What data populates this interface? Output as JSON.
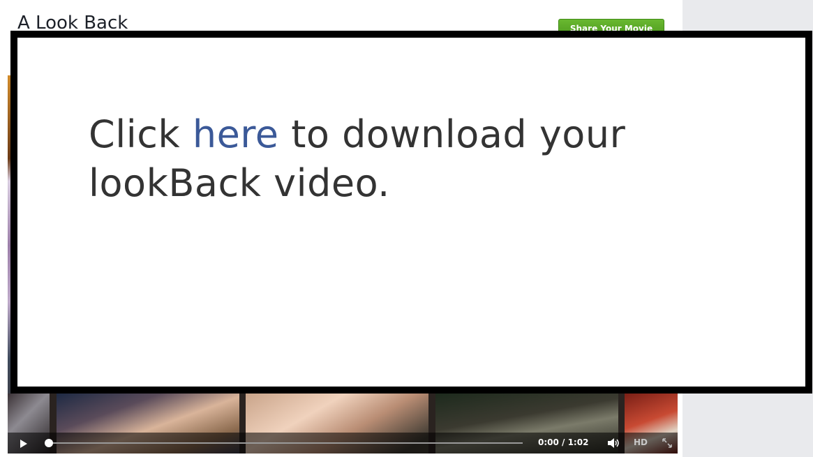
{
  "header": {
    "title": "A Look Back",
    "share_button_label": "Share Your Movie"
  },
  "video": {
    "time_readout": "0:00 / 1:02",
    "hd_label": "HD",
    "progress": 0.0
  },
  "overlay": {
    "message_before": "Click ",
    "link_text": "here",
    "message_after": " to download your lookBack video."
  },
  "icons": {
    "play": "play-icon",
    "volume": "volume-icon",
    "fullscreen": "fullscreen-icon"
  }
}
